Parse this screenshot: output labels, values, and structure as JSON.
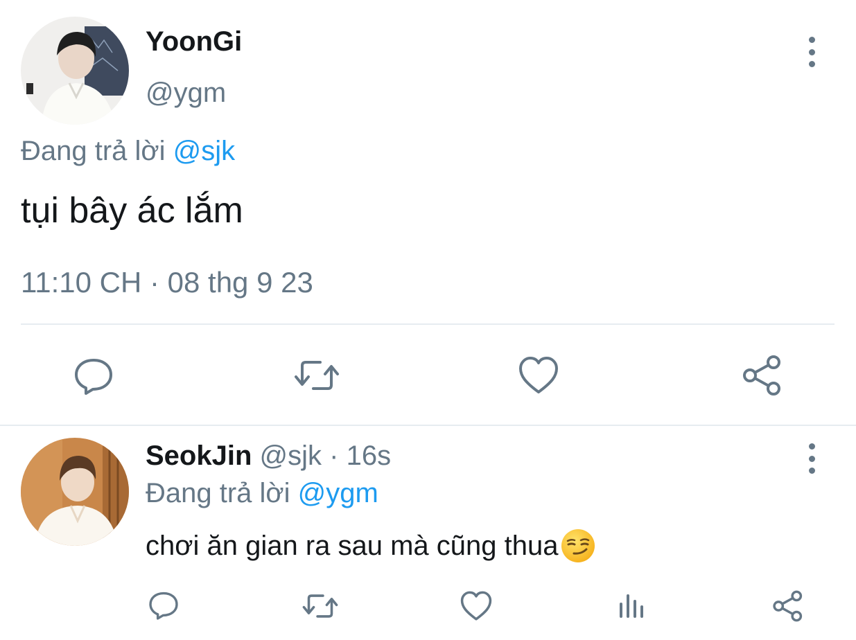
{
  "main_tweet": {
    "display_name": "YoonGi",
    "handle": "@ygm",
    "reply_prefix": "Đang trả lời",
    "reply_to": "@sjk",
    "text": "tụi bây ác lắm",
    "timestamp": "11:10 CH · 08 thg 9 23",
    "actions": [
      "reply-icon",
      "retweet-icon",
      "like-icon",
      "share-icon"
    ]
  },
  "reply_tweet": {
    "display_name": "SeokJin",
    "handle": "@sjk",
    "separator": " · ",
    "time_ago": "16s",
    "reply_prefix": "Đang trả lời",
    "reply_to": "@ygm",
    "text": "chơi ăn gian ra sau mà cũng thua",
    "emoji": "smirk-emoji",
    "actions": [
      "reply-icon",
      "retweet-icon",
      "like-icon",
      "analytics-icon",
      "share-icon"
    ]
  },
  "colors": {
    "link_blue": "#1d9bf0",
    "secondary_grey": "#657786",
    "divider": "#e6ecf0"
  }
}
